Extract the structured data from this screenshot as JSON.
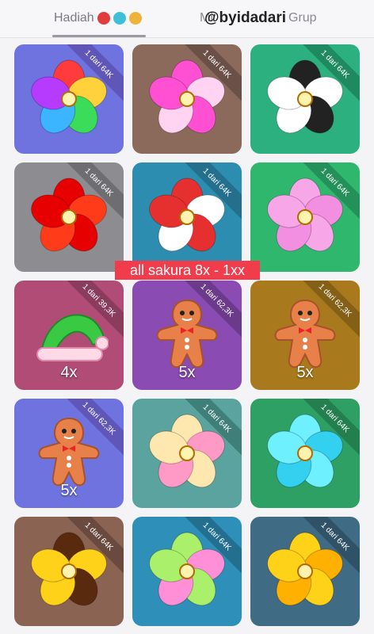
{
  "tabs": [
    {
      "label": "Hadiah",
      "active": true
    },
    {
      "label": "Mi",
      "active": false
    },
    {
      "label": "Grup",
      "active": false
    }
  ],
  "watermark": "@byidadari",
  "overlay_text": "all sakura 8x - 1xx",
  "cards": [
    {
      "ribbon": "1 dari 64K",
      "bg": "#6e73e0",
      "ribbon_color": "#5f56b8",
      "icon": "rainbow-flower-icon",
      "count": ""
    },
    {
      "ribbon": "1 dari 64K",
      "bg": "#8b6a5b",
      "ribbon_color": "#6a5047",
      "icon": "pink-yellow-flower-icon",
      "count": ""
    },
    {
      "ribbon": "1 dari 64K",
      "bg": "#2db07f",
      "ribbon_color": "#1f8a60",
      "icon": "black-white-flower-icon",
      "count": ""
    },
    {
      "ribbon": "1 dari 64K",
      "bg": "#8d8d91",
      "ribbon_color": "#6d6d72",
      "icon": "red-poppy-flower-icon",
      "count": ""
    },
    {
      "ribbon": "1 dari 64K",
      "bg": "#2c8db0",
      "ribbon_color": "#236f8c",
      "icon": "red-white-flower-icon",
      "count": ""
    },
    {
      "ribbon": "1 dari 64K",
      "bg": "#2fb86d",
      "ribbon_color": "#25915a",
      "icon": "pink-sakura-flower-icon",
      "count": ""
    },
    {
      "ribbon": "1 dari 39,3K",
      "bg": "#b04c75",
      "ribbon_color": "#8a3c5c",
      "icon": "santa-hat-icon",
      "count": "4x"
    },
    {
      "ribbon": "1 dari 62,3K",
      "bg": "#8a4bb3",
      "ribbon_color": "#6b3a8b",
      "icon": "gingerbread-man-icon",
      "count": "5x"
    },
    {
      "ribbon": "1 dari 62,3K",
      "bg": "#a87a1d",
      "ribbon_color": "#846016",
      "icon": "gingerbread-man-icon",
      "count": "5x"
    },
    {
      "ribbon": "1 dari 62,3K",
      "bg": "#6e73e0",
      "ribbon_color": "#5f56b8",
      "icon": "gingerbread-man-icon",
      "count": "5x"
    },
    {
      "ribbon": "1 dari 64K",
      "bg": "#5aa39e",
      "ribbon_color": "#3f7f7a",
      "icon": "cream-pink-flower-icon",
      "count": ""
    },
    {
      "ribbon": "1 dari 64K",
      "bg": "#2ea064",
      "ribbon_color": "#237f4e",
      "icon": "cyan-flower-icon",
      "count": ""
    },
    {
      "ribbon": "1 dari 64K",
      "bg": "#8a6352",
      "ribbon_color": "#6a4a3e",
      "icon": "brown-yellow-flower-icon",
      "count": ""
    },
    {
      "ribbon": "1 dari 64K",
      "bg": "#2e8fb8",
      "ribbon_color": "#236f90",
      "icon": "green-pink-flower-icon",
      "count": ""
    },
    {
      "ribbon": "1 dari 64K",
      "bg": "#3f6b85",
      "ribbon_color": "#2f5266",
      "icon": "yellow-flower-icon",
      "count": ""
    }
  ]
}
